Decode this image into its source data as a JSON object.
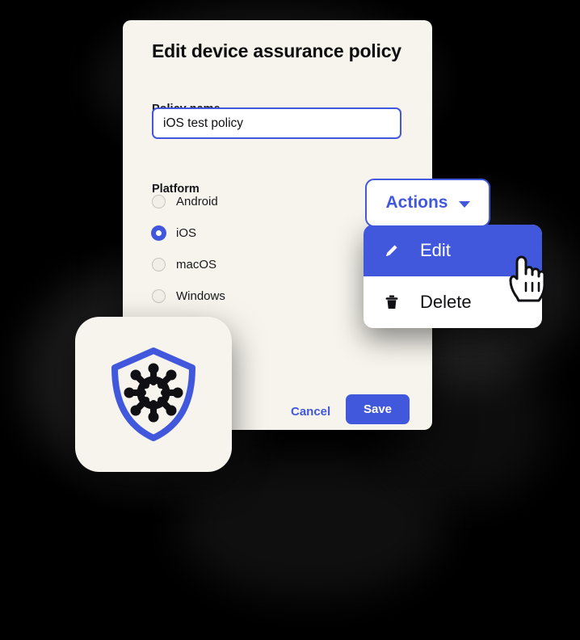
{
  "dialog": {
    "title": "Edit device assurance policy",
    "policy_name_label": "Policy name",
    "policy_name_value": "iOS test policy",
    "policy_name_placeholder": "Policy name",
    "platform_label": "Platform",
    "platform_options": [
      {
        "label": "Android",
        "selected": false
      },
      {
        "label": "iOS",
        "selected": true
      },
      {
        "label": "macOS",
        "selected": false
      },
      {
        "label": "Windows",
        "selected": false
      }
    ],
    "cancel_label": "Cancel",
    "save_label": "Save"
  },
  "actions": {
    "button_label": "Actions",
    "chevron_icon": "chevron-down-icon",
    "menu_items": [
      {
        "label": "Edit",
        "icon": "pencil-icon",
        "highlighted": true
      },
      {
        "label": "Delete",
        "icon": "trash-icon",
        "highlighted": false
      }
    ]
  },
  "logo": {
    "icon": "shield-network-icon",
    "shield_color": "#4158DD",
    "node_color": "#101014",
    "tile_color": "#F7F4ED"
  },
  "cursor": {
    "icon": "pointing-hand-cursor"
  },
  "colors": {
    "accent_blue": "#4158DD",
    "card_cream": "#F7F4ED",
    "background": "#000000",
    "text_dark": "#101014",
    "input_white": "#FFFFFF",
    "radio_unselected": "#C9C5BD"
  }
}
